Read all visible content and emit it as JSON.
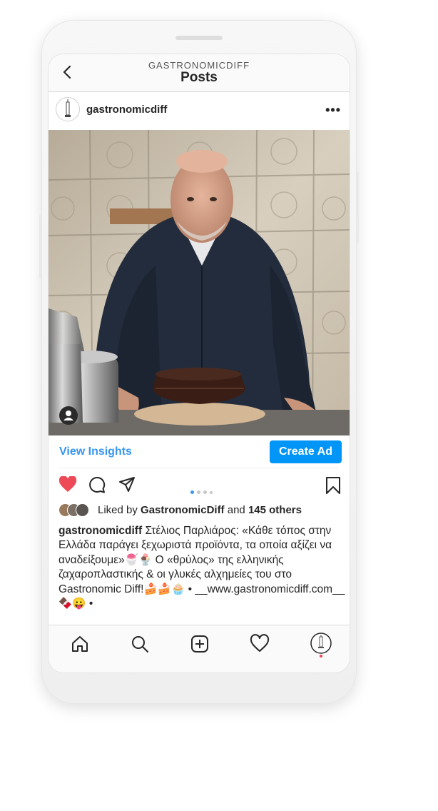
{
  "header": {
    "account_name": "GASTRONOMICDIFF",
    "title": "Posts"
  },
  "post": {
    "username": "gastronomicdiff",
    "more_label": "•••",
    "view_insights_label": "View Insights",
    "create_ad_label": "Create Ad",
    "carousel": {
      "total": 4,
      "active": 1
    },
    "likes": {
      "prefix": "Liked by",
      "name": "GastronomicDiff",
      "joiner": "and",
      "count": "145 others"
    },
    "caption": {
      "user": "gastronomicdiff",
      "text": "Στέλιος Παρλιάρος: «Κάθε τόπος στην Ελλάδα παράγει ξεχωριστά προϊόντα, τα οποία αξίζει να αναδείξουμε»🍧🍨 Ο «θρύλος» της ελληνικής ζαχαροπλαστικής & οι γλυκές αλχημείες του στο Gastronomic Diff!🍰🍰🧁 • __www.gastronomicdiff.com__ 🍫😛 •"
    }
  },
  "colors": {
    "link_blue": "#3897f0",
    "button_blue": "#0095f6",
    "like_red": "#ed4956"
  },
  "tabs": [
    "home-icon",
    "search-icon",
    "new-post-icon",
    "activity-icon",
    "profile-icon"
  ]
}
